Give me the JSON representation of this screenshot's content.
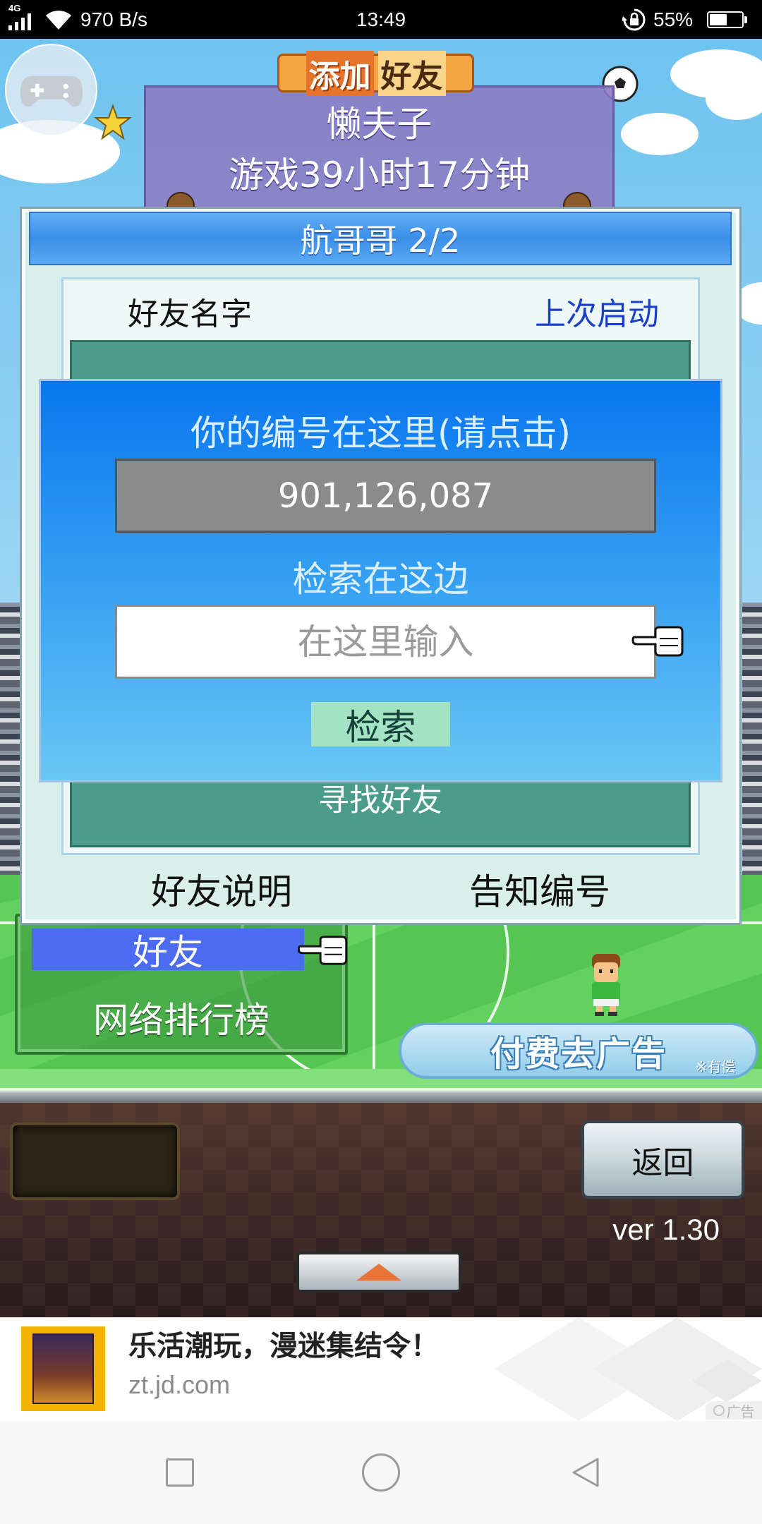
{
  "status_bar": {
    "network_type": "4G",
    "net_speed": "970 B/s",
    "time": "13:49",
    "battery": "55%"
  },
  "game": {
    "add_friend_banner": {
      "part1": "添加",
      "part2": "好友"
    },
    "profile": {
      "name": "懒夫子",
      "playtime": "游戏39小时17分钟"
    },
    "friends_dialog": {
      "title": "航哥哥 2/2",
      "column_name": "好友名字",
      "column_last_launch": "上次启动",
      "find_friends": "寻找好友",
      "help_button": "好友说明",
      "share_id_button": "告知编号"
    },
    "id_dialog": {
      "your_id_label": "你的编号在这里(请点击)",
      "your_id": "901,126,087",
      "search_label": "检索在这边",
      "search_placeholder": "在这里输入",
      "search_button": "检索"
    },
    "menu": {
      "items": [
        {
          "label": "好友",
          "selected": true
        },
        {
          "label": "网络排行榜",
          "selected": false
        }
      ]
    },
    "remove_ads": {
      "label": "付费去广告",
      "note": "※有偿"
    },
    "back_button": "返回",
    "version": "ver 1.30"
  },
  "ad": {
    "title": "乐活潮玩，漫迷集结令！",
    "url": "zt.jd.com",
    "badge": "广告"
  },
  "icons": {
    "status": [
      "cellular-signal-icon",
      "wifi-icon",
      "rotation-lock-icon",
      "battery-icon"
    ],
    "game": [
      "gamepad-icon",
      "star-icon",
      "soccer-ball-icon",
      "pointing-hand-icon",
      "up-arrow-icon"
    ],
    "nav": [
      "recents-icon",
      "home-icon",
      "back-icon"
    ]
  },
  "colors": {
    "dialog_title_bar": "#3b8fe8",
    "id_dialog_top": "#0a76ef",
    "id_dialog_bottom": "#69c7f5",
    "list_area": "#4c9c8c",
    "last_launch_header": "#1a3fcc",
    "menu_selected": "#4b6cf0",
    "search_button": "#a3e3c4",
    "banner": "#f4a440"
  }
}
